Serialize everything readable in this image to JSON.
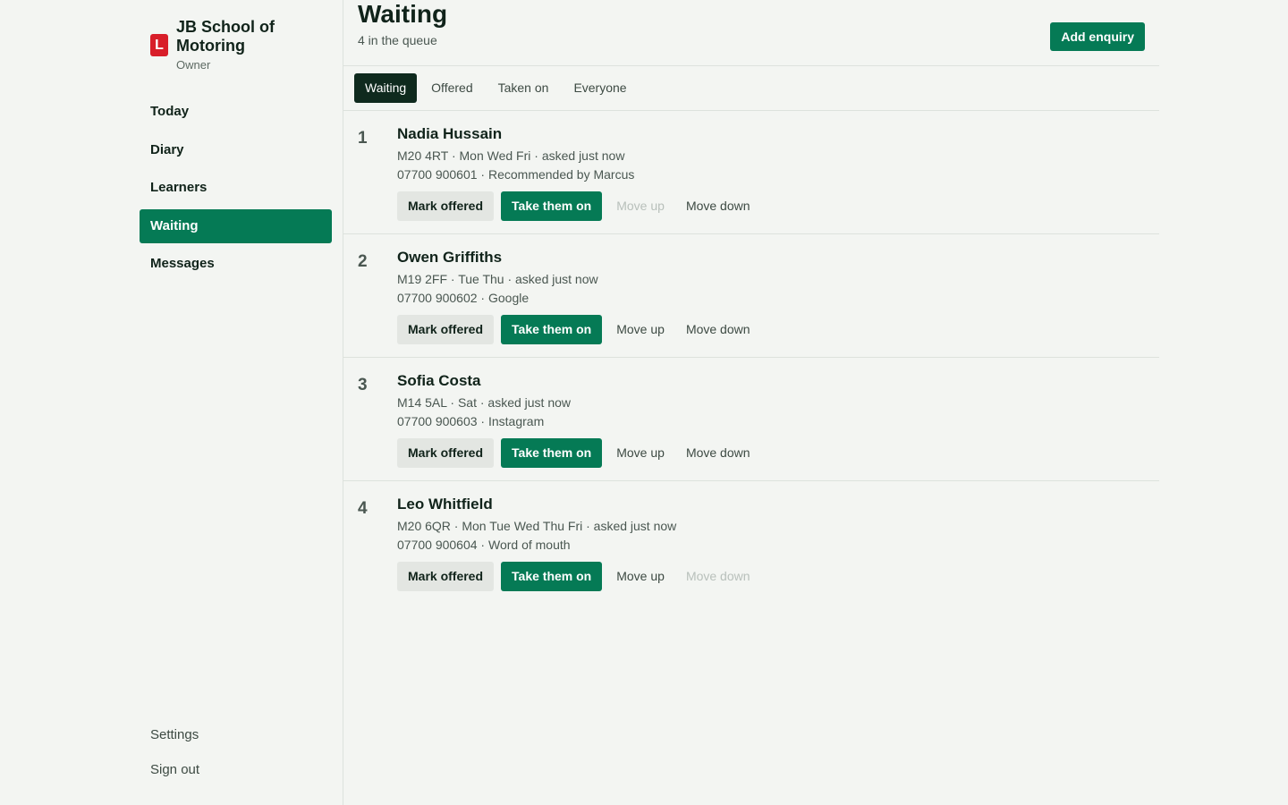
{
  "sidebar": {
    "brand_badge": "L",
    "brand_name": "JB School of Motoring",
    "brand_role": "Owner",
    "nav": [
      {
        "label": "Today",
        "active": false
      },
      {
        "label": "Diary",
        "active": false
      },
      {
        "label": "Learners",
        "active": false
      },
      {
        "label": "Waiting",
        "active": true
      },
      {
        "label": "Messages",
        "active": false
      }
    ],
    "settings_label": "Settings",
    "signout_label": "Sign out"
  },
  "header": {
    "title": "Waiting",
    "subtitle": "4 in the queue",
    "add_label": "Add enquiry"
  },
  "tabs": [
    {
      "label": "Waiting",
      "active": true
    },
    {
      "label": "Offered",
      "active": false
    },
    {
      "label": "Taken on",
      "active": false
    },
    {
      "label": "Everyone",
      "active": false
    }
  ],
  "actions": {
    "mark_offered": "Mark offered",
    "take_on": "Take them on",
    "move_up": "Move up",
    "move_down": "Move down"
  },
  "queue": [
    {
      "position": "1",
      "name": "Nadia Hussain",
      "meta": "M20 4RT · Mon Wed Fri · asked just now",
      "contact": "07700 900601 · Recommended by Marcus",
      "can_move_up": false,
      "can_move_down": true
    },
    {
      "position": "2",
      "name": "Owen Griffiths",
      "meta": "M19 2FF · Tue Thu · asked just now",
      "contact": "07700 900602 · Google",
      "can_move_up": true,
      "can_move_down": true
    },
    {
      "position": "3",
      "name": "Sofia Costa",
      "meta": "M14 5AL · Sat · asked just now",
      "contact": "07700 900603 · Instagram",
      "can_move_up": true,
      "can_move_down": true
    },
    {
      "position": "4",
      "name": "Leo Whitfield",
      "meta": "M20 6QR · Mon Tue Wed Thu Fri · asked just now",
      "contact": "07700 900604 · Word of mouth",
      "can_move_up": true,
      "can_move_down": false
    }
  ],
  "colors": {
    "accent": "#057a55",
    "brand_red": "#d81e29",
    "active_tab": "#0f2a1e",
    "background": "#f3f5f2"
  }
}
